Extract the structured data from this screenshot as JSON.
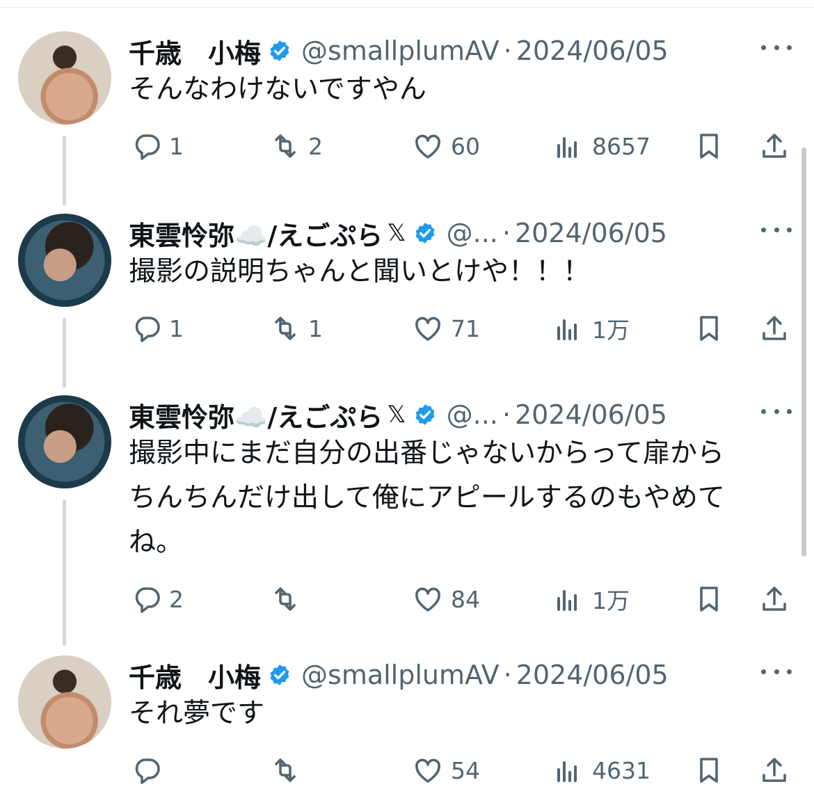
{
  "colors": {
    "text": "#0f1419",
    "muted": "#536471",
    "verified": "#1d9bf0",
    "thread_line": "#cfd9de"
  },
  "tweets": [
    {
      "name": "千歳　小梅",
      "avatar": "plum",
      "name_badge": "",
      "handle": "@smallplumAV",
      "dot": "·",
      "date": "2024/06/05",
      "lines": [
        "そんなわけないですやん"
      ],
      "replies": "1",
      "retweets": "2",
      "likes": "60",
      "views": "8657"
    },
    {
      "name": "東雲怜弥☁️/えごぷら",
      "avatar": "shino",
      "name_badge": "𝕏",
      "handle": "@...",
      "dot": "·",
      "date": "2024/06/05",
      "lines": [
        "撮影の説明ちゃんと聞いとけや！！！"
      ],
      "replies": "1",
      "retweets": "1",
      "likes": "71",
      "views": "1万"
    },
    {
      "name": "東雲怜弥☁️/えごぷら",
      "avatar": "shino",
      "name_badge": "𝕏",
      "handle": "@...",
      "dot": "·",
      "date": "2024/06/05",
      "lines": [
        "撮影中にまだ自分の出番じゃないからって扉から",
        "ちんちんだけ出して俺にアピールするのもやめて",
        "ね。"
      ],
      "replies": "2",
      "retweets": "",
      "likes": "84",
      "views": "1万"
    },
    {
      "name": "千歳　小梅",
      "avatar": "plum",
      "name_badge": "",
      "handle": "@smallplumAV",
      "dot": "·",
      "date": "2024/06/05",
      "lines": [
        "それ夢です"
      ],
      "replies": "",
      "retweets": "",
      "likes": "54",
      "views": "4631"
    }
  ],
  "icons": [
    "reply-icon",
    "retweet-icon",
    "like-icon",
    "views-icon",
    "bookmark-icon",
    "share-icon",
    "more-icon",
    "verified-icon"
  ]
}
